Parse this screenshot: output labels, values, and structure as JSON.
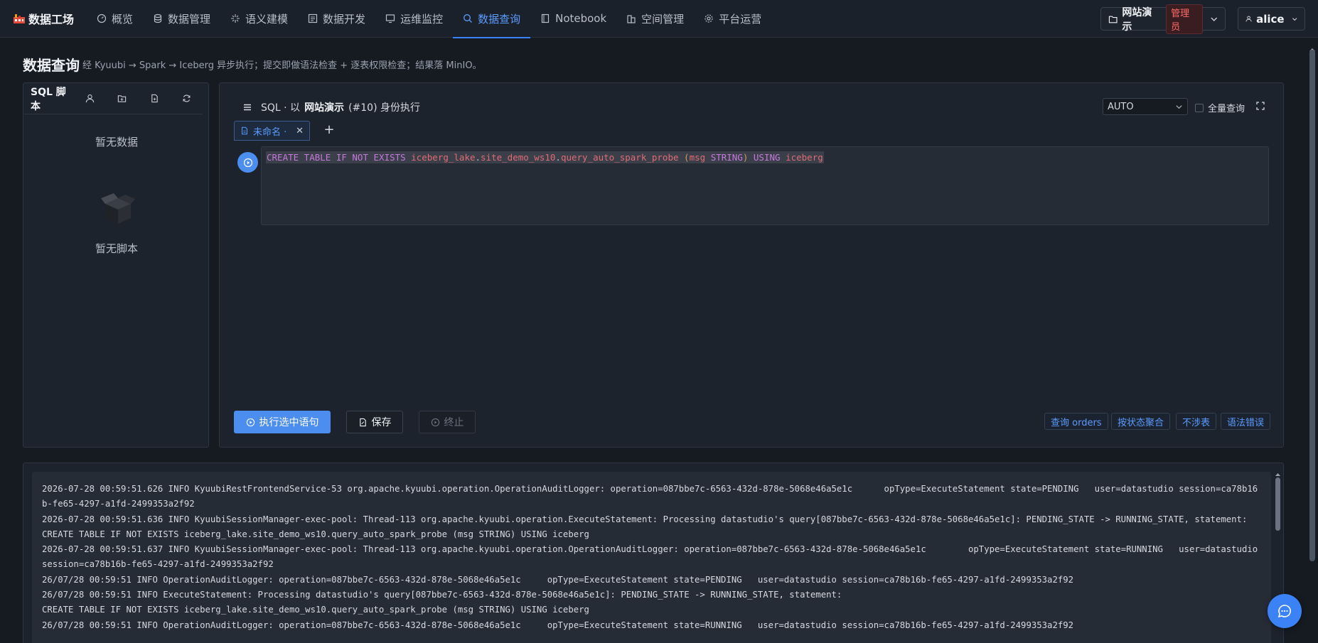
{
  "app": {
    "logo_text": "数据工场"
  },
  "nav": {
    "items": [
      {
        "label": "概览",
        "icon": "dashboard-icon"
      },
      {
        "label": "数据管理",
        "icon": "database-icon"
      },
      {
        "label": "语义建模",
        "icon": "sparkle-icon"
      },
      {
        "label": "数据开发",
        "icon": "code-icon"
      },
      {
        "label": "运维监控",
        "icon": "monitor-icon"
      },
      {
        "label": "数据查询",
        "icon": "search-icon",
        "active": true
      },
      {
        "label": "Notebook",
        "icon": "notebook-icon"
      },
      {
        "label": "空间管理",
        "icon": "building-icon"
      },
      {
        "label": "平台运营",
        "icon": "gear-icon"
      }
    ]
  },
  "workspace": {
    "name": "网站演示",
    "role": "管理员"
  },
  "user": {
    "name": "alice"
  },
  "page": {
    "title": "数据查询",
    "description": "经 Kyuubi → Spark → Iceberg 异步执行；提交即做语法检查 + 逐表权限检查；结果落 MinIO。"
  },
  "scripts_panel": {
    "title": "SQL 脚本",
    "empty_data": "暂无数据",
    "empty_scripts": "暂无脚本"
  },
  "editor": {
    "mode_prefix": "SQL · 以",
    "workspace_name": "网站演示",
    "identity_suffix": "(#10) 身份执行",
    "engine_select": "AUTO",
    "full_query_label": "全量查询",
    "tab_label": "未命名 ·",
    "sql": {
      "kw1": "CREATE TABLE IF NOT EXISTS",
      "table": "iceberg_lake",
      "dot1": ".",
      "schema": "site_demo_ws10",
      "dot2": ".",
      "name": "query_auto_spark_probe",
      "open": "(",
      "col": "msg",
      "type": "STRING",
      "close": ")",
      "kw2": "USING",
      "fmt": "iceberg"
    },
    "run_label": "执行选中语句",
    "save_label": "保存",
    "stop_label": "终止",
    "quick_buttons": [
      "查询 orders",
      "按状态聚合",
      "不涉表",
      "语法错误"
    ]
  },
  "log": {
    "lines": [
      "2026-07-28 00:59:51.626 INFO KyuubiRestFrontendService-53 org.apache.kyuubi.operation.OperationAuditLogger: operation=087bbe7c-6563-432d-878e-5068e46a5e1c\topType=ExecuteStatement state=PENDING   user=datastudio session=ca78b16b-fe65-4297-a1fd-2499353a2f92",
      "2026-07-28 00:59:51.636 INFO KyuubiSessionManager-exec-pool: Thread-113 org.apache.kyuubi.operation.ExecuteStatement: Processing datastudio's query[087bbe7c-6563-432d-878e-5068e46a5e1c]: PENDING_STATE -> RUNNING_STATE, statement:",
      "CREATE TABLE IF NOT EXISTS iceberg_lake.site_demo_ws10.query_auto_spark_probe (msg STRING) USING iceberg",
      "2026-07-28 00:59:51.637 INFO KyuubiSessionManager-exec-pool: Thread-113 org.apache.kyuubi.operation.OperationAuditLogger: operation=087bbe7c-6563-432d-878e-5068e46a5e1c\topType=ExecuteStatement state=RUNNING   user=datastudio   session=ca78b16b-fe65-4297-a1fd-2499353a2f92",
      "26/07/28 00:59:51 INFO OperationAuditLogger: operation=087bbe7c-6563-432d-878e-5068e46a5e1c\topType=ExecuteStatement state=PENDING   user=datastudio session=ca78b16b-fe65-4297-a1fd-2499353a2f92",
      "26/07/28 00:59:51 INFO ExecuteStatement: Processing datastudio's query[087bbe7c-6563-432d-878e-5068e46a5e1c]: PENDING_STATE -> RUNNING_STATE, statement:",
      "CREATE TABLE IF NOT EXISTS iceberg_lake.site_demo_ws10.query_auto_spark_probe (msg STRING) USING iceberg",
      "26/07/28 00:59:51 INFO OperationAuditLogger: operation=087bbe7c-6563-432d-878e-5068e46a5e1c\topType=ExecuteStatement state=RUNNING   user=datastudio session=ca78b16b-fe65-4297-a1fd-2499353a2f92"
    ]
  },
  "colors": {
    "accent": "#3b82f6",
    "background": "#161b22",
    "panel": "#1d232d"
  }
}
